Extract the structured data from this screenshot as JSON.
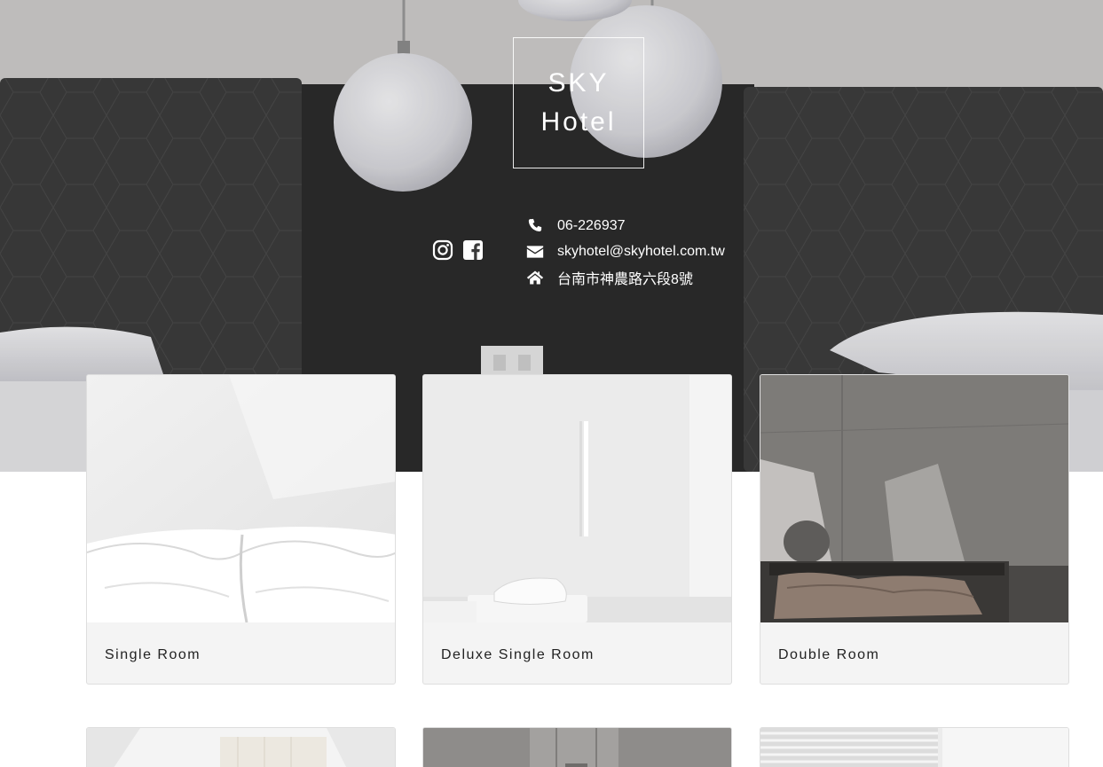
{
  "brand": {
    "line1": "SKY",
    "line2": "Hotel"
  },
  "contact": {
    "phone": "06-226937",
    "email": "skyhotel@skyhotel.com.tw",
    "address": "台南市神農路六段8號"
  },
  "social": {
    "instagram_icon": "instagram-icon",
    "facebook_icon": "facebook-icon"
  },
  "rooms": [
    {
      "name": "Single Room"
    },
    {
      "name": "Deluxe Single Room"
    },
    {
      "name": "Double Room"
    }
  ],
  "colors": {
    "card_bg": "#f4f4f4",
    "hero_dark": "#3a3a3a",
    "text": "#222222"
  }
}
